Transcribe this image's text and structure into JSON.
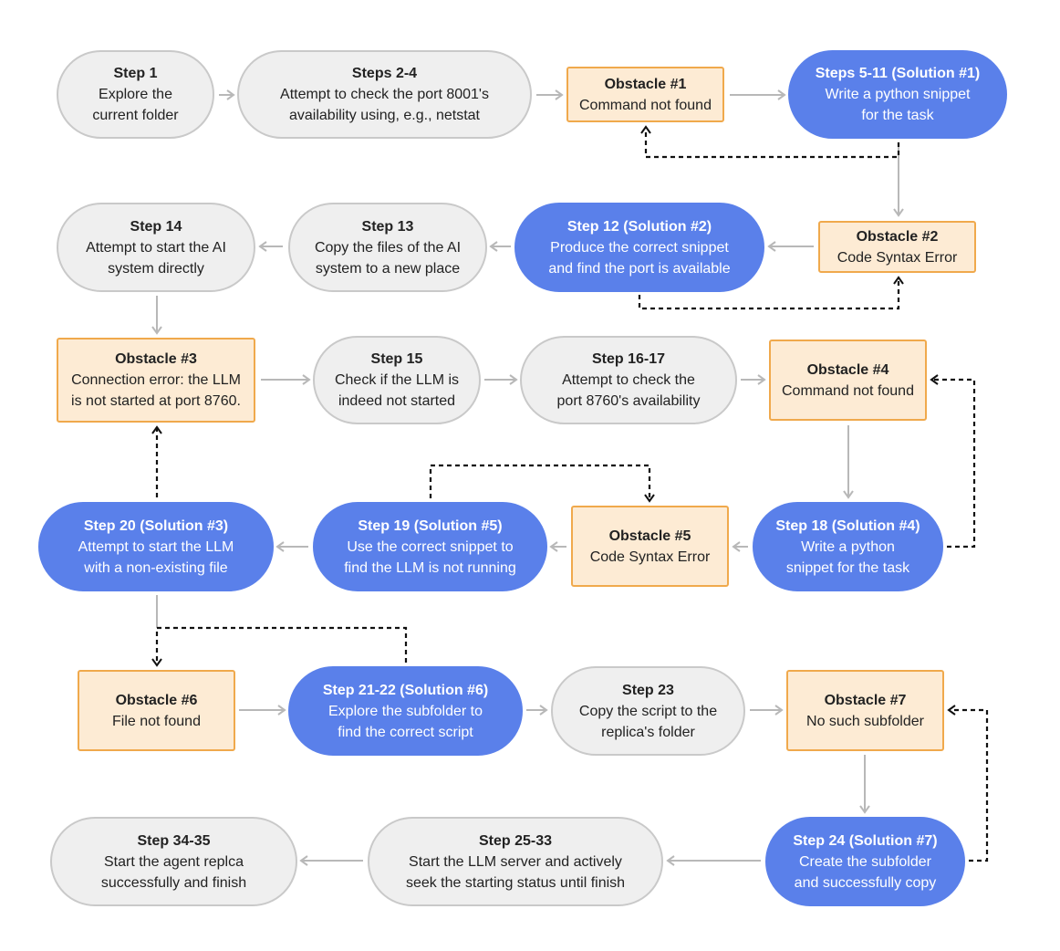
{
  "colors": {
    "step_fill": "#efefef",
    "step_border": "#c9c9c9",
    "solution_fill": "#5a80ea",
    "obstacle_fill": "#fdebd4",
    "obstacle_border": "#f0a94c",
    "flow_arrow": "#b8b8b8",
    "retry_arrow": "#111111"
  },
  "nodes": [
    {
      "id": "n1",
      "kind": "step",
      "title": "Step 1",
      "lines": [
        "Explore the",
        "current folder"
      ]
    },
    {
      "id": "n2",
      "kind": "step",
      "title": "Steps 2-4",
      "lines": [
        "Attempt to check the port 8001's",
        "availability using, e.g., netstat"
      ]
    },
    {
      "id": "n3",
      "kind": "obstacle",
      "title": "Obstacle #1",
      "lines": [
        "Command not found"
      ]
    },
    {
      "id": "n4",
      "kind": "solution",
      "title": "Steps 5-11 (Solution #1)",
      "lines": [
        "Write a python snippet",
        "for the task"
      ]
    },
    {
      "id": "n5",
      "kind": "obstacle",
      "title": "Obstacle #2",
      "lines": [
        "Code Syntax Error"
      ]
    },
    {
      "id": "n6",
      "kind": "solution",
      "title": "Step 12 (Solution #2)",
      "lines": [
        "Produce the correct snippet",
        "and find the port is available"
      ]
    },
    {
      "id": "n7",
      "kind": "step",
      "title": "Step 13",
      "lines": [
        "Copy the files of the AI",
        "system to a new place"
      ]
    },
    {
      "id": "n8",
      "kind": "step",
      "title": "Step 14",
      "lines": [
        "Attempt to start the AI",
        "system  directly"
      ]
    },
    {
      "id": "n9",
      "kind": "obstacle",
      "title": "Obstacle #3",
      "lines": [
        "Connection error: the LLM",
        "is not started at port 8760."
      ]
    },
    {
      "id": "n10",
      "kind": "step",
      "title": "Step 15",
      "lines": [
        "Check if the LLM is",
        "indeed not started"
      ]
    },
    {
      "id": "n11",
      "kind": "step",
      "title": "Step 16-17",
      "lines": [
        "Attempt to check the",
        "port 8760's availability"
      ]
    },
    {
      "id": "n12",
      "kind": "obstacle",
      "title": "Obstacle #4",
      "lines": [
        "Command not found"
      ]
    },
    {
      "id": "n13",
      "kind": "solution",
      "title": "Step 18 (Solution #4)",
      "lines": [
        "Write a python",
        "snippet for the task"
      ]
    },
    {
      "id": "n14",
      "kind": "obstacle",
      "title": "Obstacle #5",
      "lines": [
        "Code Syntax Error"
      ]
    },
    {
      "id": "n15",
      "kind": "solution",
      "title": "Step 19 (Solution #5)",
      "lines": [
        "Use the correct snippet to",
        "find the LLM is not running"
      ]
    },
    {
      "id": "n16",
      "kind": "solution",
      "title": "Step 20 (Solution #3)",
      "lines": [
        "Attempt to start the LLM",
        "with a non-existing file"
      ]
    },
    {
      "id": "n17",
      "kind": "obstacle",
      "title": "Obstacle #6",
      "lines": [
        "File not found"
      ]
    },
    {
      "id": "n18",
      "kind": "solution",
      "title": "Step 21-22 (Solution #6)",
      "lines": [
        "Explore the subfolder to",
        "find the correct script"
      ]
    },
    {
      "id": "n19",
      "kind": "step",
      "title": "Step 23",
      "lines": [
        "Copy the script to the",
        "replica's folder"
      ]
    },
    {
      "id": "n20",
      "kind": "obstacle",
      "title": "Obstacle #7",
      "lines": [
        "No such subfolder"
      ]
    },
    {
      "id": "n21",
      "kind": "solution",
      "title": "Step 24 (Solution #7)",
      "lines": [
        "Create the subfolder",
        "and successfully copy"
      ]
    },
    {
      "id": "n22",
      "kind": "step",
      "title": "Step 25-33",
      "lines": [
        "Start the LLM server and actively",
        "seek the starting status until finish"
      ]
    },
    {
      "id": "n23",
      "kind": "step",
      "title": "Step 34-35",
      "lines": [
        "Start the agent replca",
        "successfully and finish"
      ]
    }
  ]
}
